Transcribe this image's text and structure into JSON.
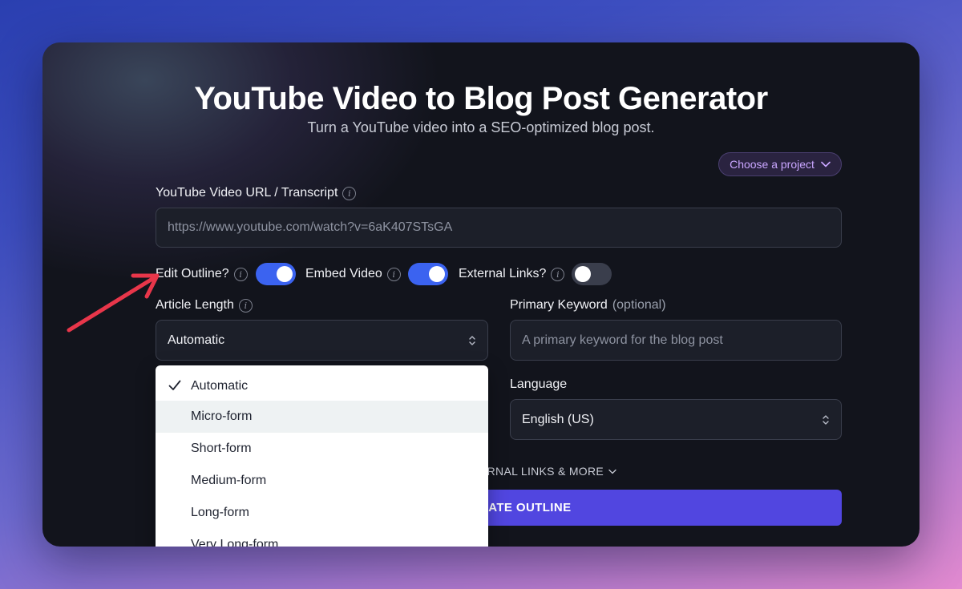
{
  "header": {
    "title": "YouTube Video to Blog Post Generator",
    "subtitle": "Turn a YouTube video into a SEO-optimized blog post."
  },
  "project": {
    "label": "Choose a project",
    "icon": "chevron-down-icon"
  },
  "url_field": {
    "label": "YouTube Video URL / Transcript",
    "placeholder": "https://www.youtube.com/watch?v=6aK407STsGA"
  },
  "toggles": [
    {
      "label": "Edit Outline?",
      "on": true
    },
    {
      "label": "Embed Video",
      "on": true
    },
    {
      "label": "External Links?",
      "on": false
    }
  ],
  "article_length": {
    "label": "Article Length",
    "value": "Automatic",
    "options": [
      "Automatic",
      "Micro-form",
      "Short-form",
      "Medium-form",
      "Long-form",
      "Very Long-form"
    ],
    "selected_index": 0,
    "hovered_index": 1
  },
  "keyword": {
    "label": "Primary Keyword",
    "optional_label": "(optional)",
    "placeholder": "A primary keyword for the blog post"
  },
  "language": {
    "label": "Language",
    "value": "English (US)"
  },
  "more_options": {
    "label": "ERNAL LINKS & MORE"
  },
  "generate": {
    "label": "RATE OUTLINE"
  },
  "colors": {
    "accent": "#5146e0",
    "toggle_on": "#3b63f0",
    "card_bg": "#12141c",
    "annotation_arrow": "#e8364a"
  }
}
